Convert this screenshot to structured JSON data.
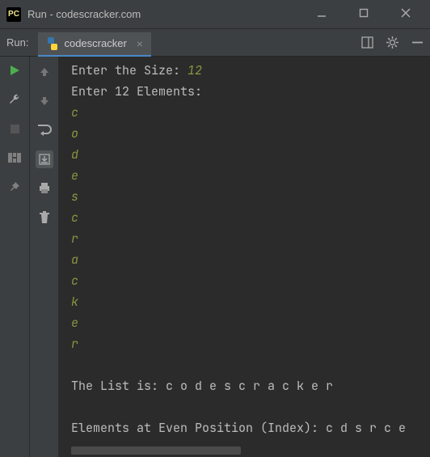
{
  "titlebar": {
    "title": "Run - codescracker.com"
  },
  "toolbar": {
    "run_label": "Run:",
    "tab_label": "codescracker"
  },
  "console": {
    "prompt_size": "Enter the Size: ",
    "size_value": "12",
    "prompt_elements": "Enter 12 Elements:",
    "elements": [
      "c",
      "o",
      "d",
      "e",
      "s",
      "c",
      "r",
      "a",
      "c",
      "k",
      "e",
      "r"
    ],
    "list_label": "The List is: ",
    "list_values": "c o d e s c r a c k e r",
    "even_label": "Elements at Even Position (Index): ",
    "even_values": "c d s r c e"
  }
}
